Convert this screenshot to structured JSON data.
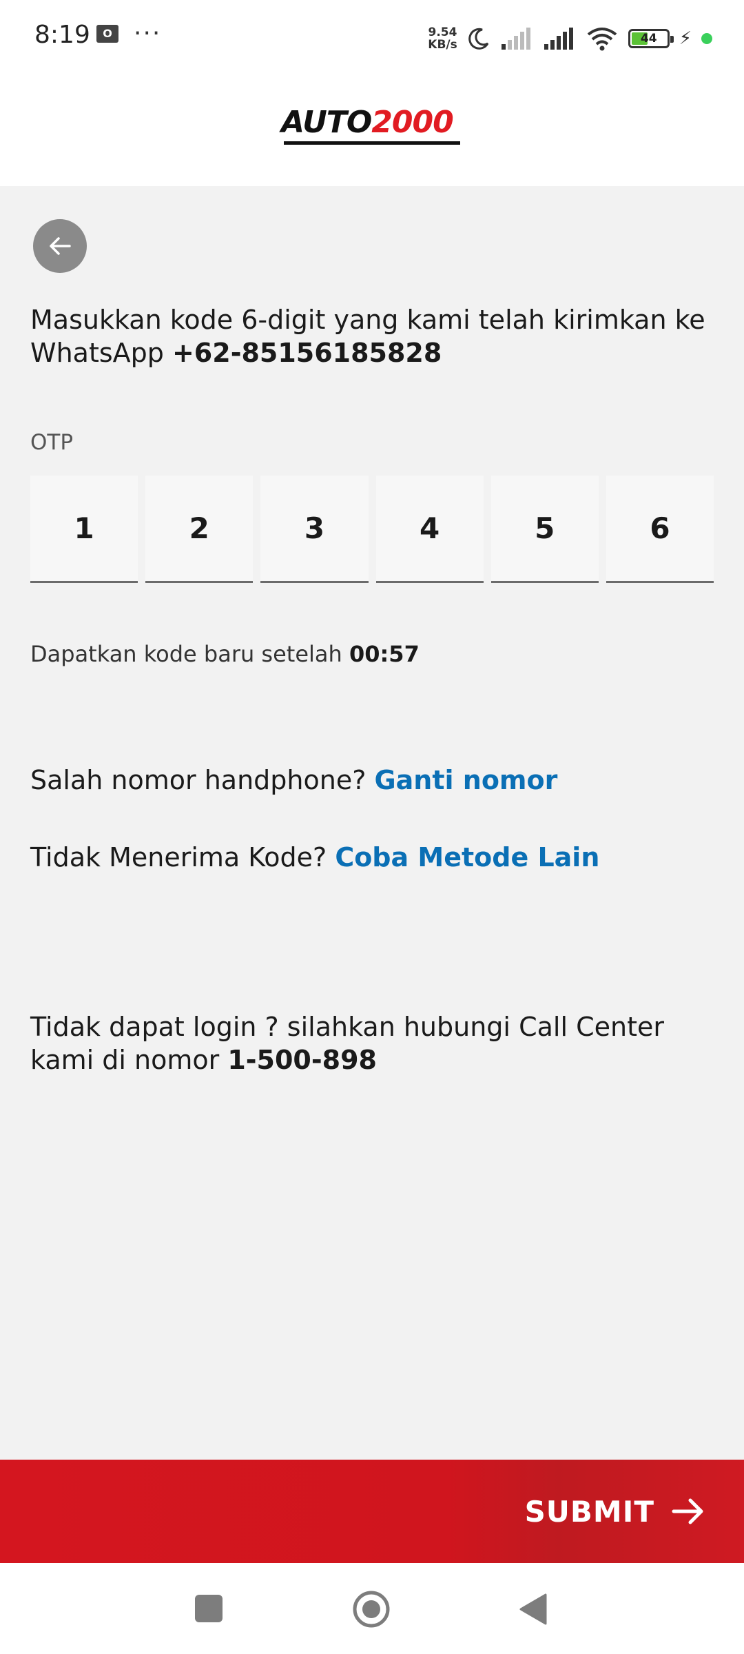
{
  "status_bar": {
    "time": "8:19",
    "dots": "···",
    "net_speed_value": "9.54",
    "net_speed_unit": "KB/s",
    "battery_level": "44"
  },
  "header": {
    "logo_auto": "AUTO",
    "logo_number": "2000",
    "logo_colors": {
      "auto": "#111111",
      "number": "#e11b22"
    }
  },
  "content": {
    "instruction_prefix": "Masukkan kode 6-digit yang kami telah kirimkan ke WhatsApp ",
    "phone_number": "+62-85156185828",
    "otp_label": "OTP",
    "otp_digits": [
      "1",
      "2",
      "3",
      "4",
      "5",
      "6"
    ],
    "resend_prefix": "Dapatkan kode baru setelah ",
    "resend_timer": "00:57",
    "wrong_number_text": "Salah nomor handphone? ",
    "wrong_number_link": "Ganti nomor",
    "no_code_text": "Tidak Menerima Kode? ",
    "no_code_link": "Coba Metode Lain",
    "call_center_text": "Tidak dapat login ? silahkan hubungi Call Center kami di nomor ",
    "call_center_number": "1-500-898",
    "link_color": "#0a6fb5"
  },
  "footer": {
    "submit_label": "SUBMIT",
    "submit_color": "#d4161f"
  },
  "icons": {
    "back": "arrow-left-icon",
    "submit": "arrow-right-icon"
  }
}
